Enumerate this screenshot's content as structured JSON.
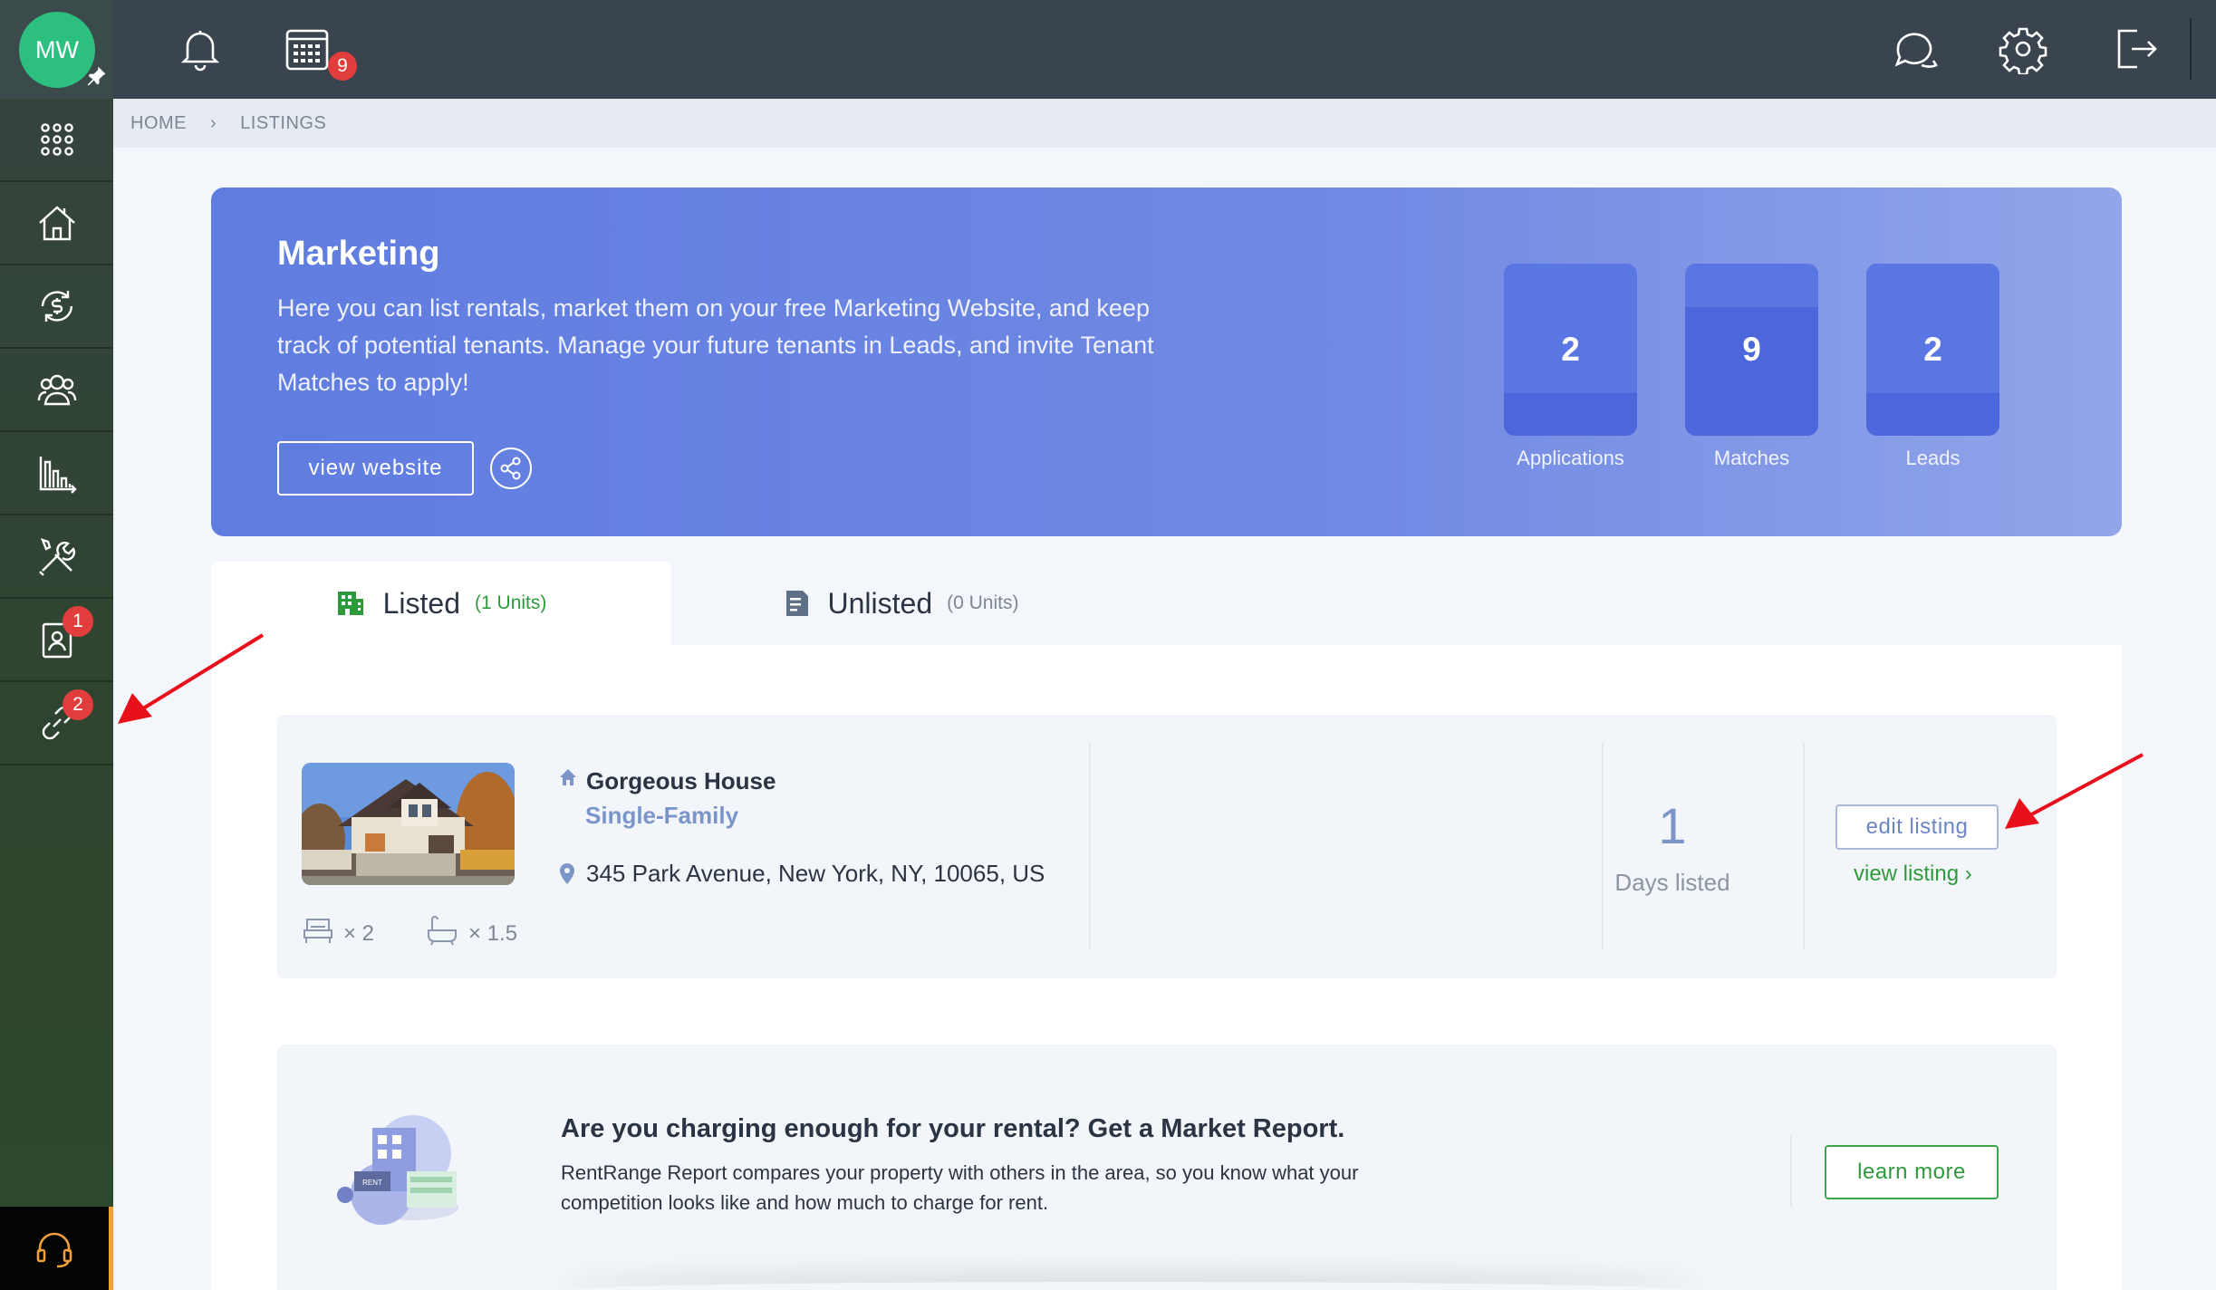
{
  "user": {
    "initials": "MW"
  },
  "topbar": {
    "notifications_count": "9"
  },
  "sidebar": {
    "items": [
      {
        "name": "apps",
        "icon": "grid-icon"
      },
      {
        "name": "properties",
        "icon": "house-icon"
      },
      {
        "name": "payments",
        "icon": "dollar-cycle-icon"
      },
      {
        "name": "people",
        "icon": "users-icon"
      },
      {
        "name": "reports",
        "icon": "bar-chart-icon"
      },
      {
        "name": "maintenance",
        "icon": "tools-icon"
      },
      {
        "name": "applicants",
        "icon": "contact-card-icon",
        "badge": "1"
      },
      {
        "name": "listings",
        "icon": "link-icon",
        "badge": "2"
      }
    ]
  },
  "breadcrumb": {
    "home": "HOME",
    "current": "LISTINGS"
  },
  "marketing": {
    "title": "Marketing",
    "description": "Here you can list rentals, market them on your free Marketing Website, and keep track of potential tenants. Manage your future tenants in Leads, and invite Tenant Matches to apply!",
    "view_website_label": "view website",
    "stats": [
      {
        "value": "2",
        "label": "Applications"
      },
      {
        "value": "9",
        "label": "Matches"
      },
      {
        "value": "2",
        "label": "Leads"
      }
    ]
  },
  "tabs": {
    "listed": {
      "label": "Listed",
      "count": "(1 Units)"
    },
    "unlisted": {
      "label": "Unlisted",
      "count": "(0 Units)"
    }
  },
  "listing": {
    "title": "Gorgeous House",
    "type": "Single-Family",
    "address": "345 Park Avenue, New York, NY, 10065, US",
    "beds": "× 2",
    "baths": "× 1.5",
    "days_listed_value": "1",
    "days_listed_label": "Days listed",
    "edit_label": "edit listing",
    "view_label": "view listing ›"
  },
  "report": {
    "title": "Are you charging enough for your rental? Get a Market Report.",
    "description": "RentRange Report compares your property with others in the area, so you know what your competition looks like and how much to charge for rent.",
    "learn_more_label": "learn more",
    "illustration_sign": "RENT"
  },
  "colors": {
    "accent": "#6079e0",
    "green": "#2e9b3a",
    "badge": "#e23d3d",
    "annotation_arrow": "#e8101a"
  }
}
